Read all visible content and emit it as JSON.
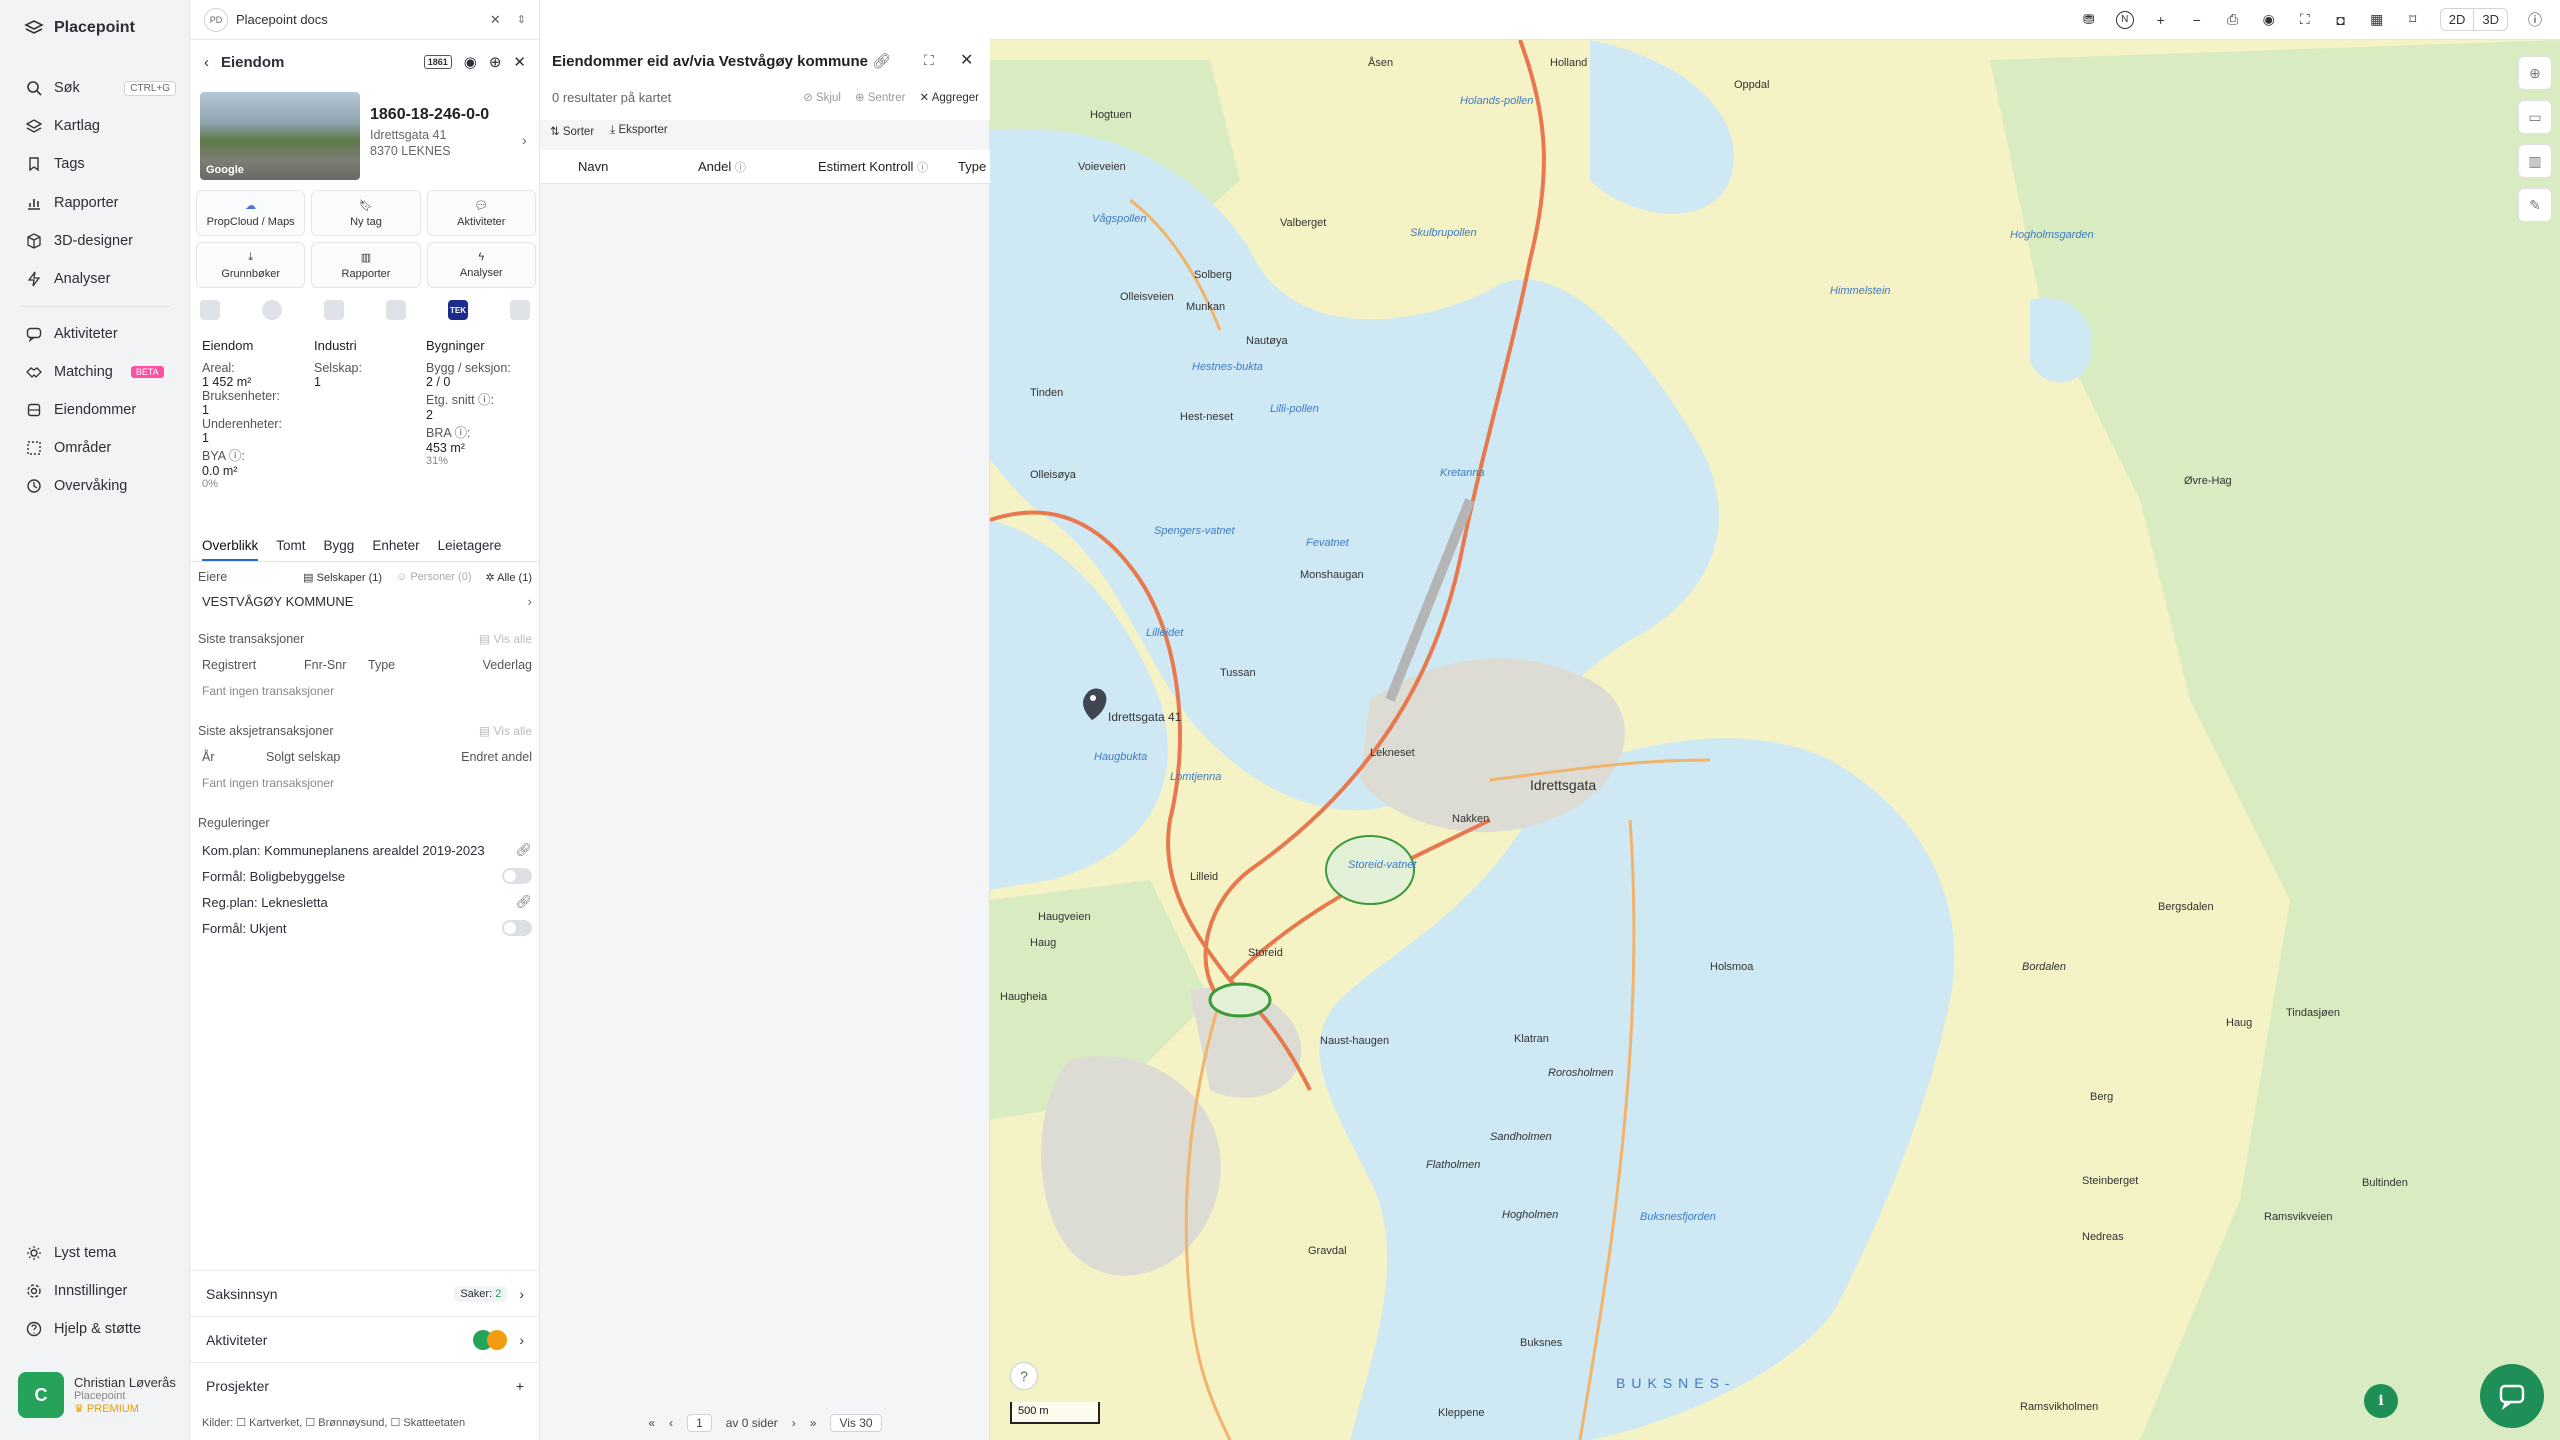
{
  "nav": {
    "brand": "Placepoint",
    "items": [
      {
        "label": "Søk",
        "kbd": "CTRL+G",
        "icon": "search-icon"
      },
      {
        "label": "Kartlag",
        "icon": "layers-icon"
      },
      {
        "label": "Tags",
        "icon": "bookmark-icon"
      },
      {
        "label": "Rapporter",
        "icon": "chart-icon"
      },
      {
        "label": "3D-designer",
        "icon": "cube-icon"
      },
      {
        "label": "Analyser",
        "icon": "bolt-icon"
      },
      {
        "label": "Aktiviteter",
        "icon": "chat-icon"
      },
      {
        "label": "Matching",
        "badge": "BETA",
        "icon": "handshake-icon"
      },
      {
        "label": "Eiendommer",
        "icon": "building-icon"
      },
      {
        "label": "Områder",
        "icon": "area-icon"
      },
      {
        "label": "Overvåking",
        "icon": "eye-icon"
      }
    ],
    "bottom": [
      {
        "label": "Lyst tema",
        "icon": "sun-icon"
      },
      {
        "label": "Innstillinger",
        "icon": "gear-icon"
      },
      {
        "label": "Hjelp & støtte",
        "icon": "help-icon"
      }
    ],
    "user": {
      "initial": "C",
      "name": "Christian Løverås",
      "org": "Placepoint",
      "plan": "PREMIUM"
    }
  },
  "panel": {
    "tab": {
      "badge": "PD",
      "title": "Placepoint docs"
    },
    "header": {
      "title": "Eiendom",
      "badge": "1861"
    },
    "photo_label": "Google",
    "property": {
      "id": "1860-18-246-0-0",
      "street": "Idrettsgata 41",
      "city": "8370 LEKNES"
    },
    "buttons": [
      "PropCloud / Maps",
      "Ny tag",
      "Aktiviteter",
      "Grunnbøker",
      "Rapporter",
      "Analyser"
    ],
    "icons_tek": "TEK",
    "stats": {
      "eiendom": {
        "h": "Eiendom",
        "areal_l": "Areal:",
        "areal_v": "1 452 m²",
        "bruks_l": "Bruksenheter:",
        "bruks_v": "1",
        "under_l": "Underenheter:",
        "under_v": "1",
        "bya_l": "BYA ⓘ:",
        "bya_v": "0.0 m²",
        "bya_p": "0%"
      },
      "industri": {
        "h": "Industri",
        "sel_l": "Selskap:",
        "sel_v": "1"
      },
      "bygninger": {
        "h": "Bygninger",
        "bygg_l": "Bygg / seksjon:",
        "bygg_v": "2 / 0",
        "etg_l": "Etg. snitt ⓘ:",
        "etg_v": "2",
        "bra_l": "BRA ⓘ:",
        "bra_v": "453 m²",
        "bra_p": "31%"
      }
    },
    "tabs": [
      "Overblikk",
      "Tomt",
      "Bygg",
      "Enheter",
      "Leietagere"
    ],
    "eiere": {
      "label": "Eiere",
      "f1": "Selskaper (1)",
      "f2": "Personer (0)",
      "f3": "Alle (1)",
      "owner": "VESTVÅGØY KOMMUNE"
    },
    "trans": {
      "title": "Siste transaksjoner",
      "vis": "Vis alle",
      "cols": [
        "Registrert",
        "Fnr-Snr",
        "Type",
        "Vederlag"
      ],
      "empty": "Fant ingen transaksjoner"
    },
    "aksje": {
      "title": "Siste aksjetransaksjoner",
      "vis": "Vis alle",
      "cols": [
        "År",
        "Solgt selskap",
        "Endret andel"
      ],
      "empty": "Fant ingen transaksjoner"
    },
    "reg": {
      "title": "Reguleringer",
      "r1": "Kom.plan: Kommuneplanens arealdel 2019-2023",
      "r2": "Formål: Boligbebyggelse",
      "r3": "Reg.plan: Leknesletta",
      "r4": "Formål: Ukjent"
    },
    "saks": {
      "label": "Saksinnsyn",
      "count_l": "Saker:",
      "count_v": "2"
    },
    "akt": {
      "label": "Aktiviteter"
    },
    "proj": {
      "label": "Prosjekter",
      "plus": "+"
    },
    "sources": "Kilder: ☐ Kartverket, ☐ Brønnøysund, ☐ Skatteetaten"
  },
  "p3": {
    "title": "Eiendommer eid av/via Vestvågøy kommune",
    "results": "0 resultater på kartet",
    "acts": [
      "Skjul",
      "Sentrer",
      "Aggreger"
    ],
    "bar": [
      "Sorter",
      "Eksporter"
    ],
    "cols": [
      "Navn",
      "Andel",
      "Estimert Kontroll",
      "Type"
    ],
    "pager": {
      "page": "1",
      "of": "av 0 sider",
      "vis": "Vis 30"
    }
  },
  "map": {
    "view": [
      "2D",
      "3D"
    ],
    "scale": "500 m",
    "marker": "Idrettsgata 41",
    "places": [
      {
        "t": "Åsen"
      },
      {
        "t": "Holland"
      },
      {
        "t": "Oppdal"
      },
      {
        "t": "Hogtuen"
      },
      {
        "t": "Holands-pollen"
      },
      {
        "t": "Voieveien"
      },
      {
        "t": "Vågspollen"
      },
      {
        "t": "Valberget"
      },
      {
        "t": "Solberg"
      },
      {
        "t": "Munkan"
      },
      {
        "t": "Olleisveien"
      },
      {
        "t": "Skulbrupollen"
      },
      {
        "t": "Nautøya"
      },
      {
        "t": "Hestnes-bukta"
      },
      {
        "t": "Lilli-pollen"
      },
      {
        "t": "Tinden"
      },
      {
        "t": "Hest-neset"
      },
      {
        "t": "Kretanna"
      },
      {
        "t": "Olleisøya"
      },
      {
        "t": "Spengers-vatnet"
      },
      {
        "t": "Monshaugan"
      },
      {
        "t": "Fevatnet"
      },
      {
        "t": "Lilleidet"
      },
      {
        "t": "Tussan"
      },
      {
        "t": "Lekneset"
      },
      {
        "t": "Idrettsgata"
      },
      {
        "t": "Haugbukta"
      },
      {
        "t": "Lomtjenna"
      },
      {
        "t": "Nakken"
      },
      {
        "t": "Storeid-vatnet"
      },
      {
        "t": "Lilleid"
      },
      {
        "t": "Haugveien"
      },
      {
        "t": "Storeid"
      },
      {
        "t": "Haug"
      },
      {
        "t": "Haugheia"
      },
      {
        "t": "Naust-haugen"
      },
      {
        "t": "Klatran"
      },
      {
        "t": "Rorosholmen"
      },
      {
        "t": "Holsmoa"
      },
      {
        "t": "Sandholmen"
      },
      {
        "t": "Flatholmen"
      },
      {
        "t": "Hogholmen"
      },
      {
        "t": "Buksnesfjorden"
      },
      {
        "t": "BUKSNES-"
      },
      {
        "t": "Gravdal"
      },
      {
        "t": "Buksnes"
      },
      {
        "t": "Kleppene"
      },
      {
        "t": "Himmelstein"
      },
      {
        "t": "Hogholmsgarden"
      },
      {
        "t": "Øvre-Hag"
      },
      {
        "t": "Haug"
      },
      {
        "t": "Ramsvikveien"
      },
      {
        "t": "Bergsdalen"
      },
      {
        "t": "Tindasjøen"
      },
      {
        "t": "Bordalen"
      },
      {
        "t": "Berg"
      },
      {
        "t": "Steinberget"
      },
      {
        "t": "Bultinden"
      },
      {
        "t": "Nedreas"
      },
      {
        "t": "Ramsvikholmen"
      }
    ]
  }
}
